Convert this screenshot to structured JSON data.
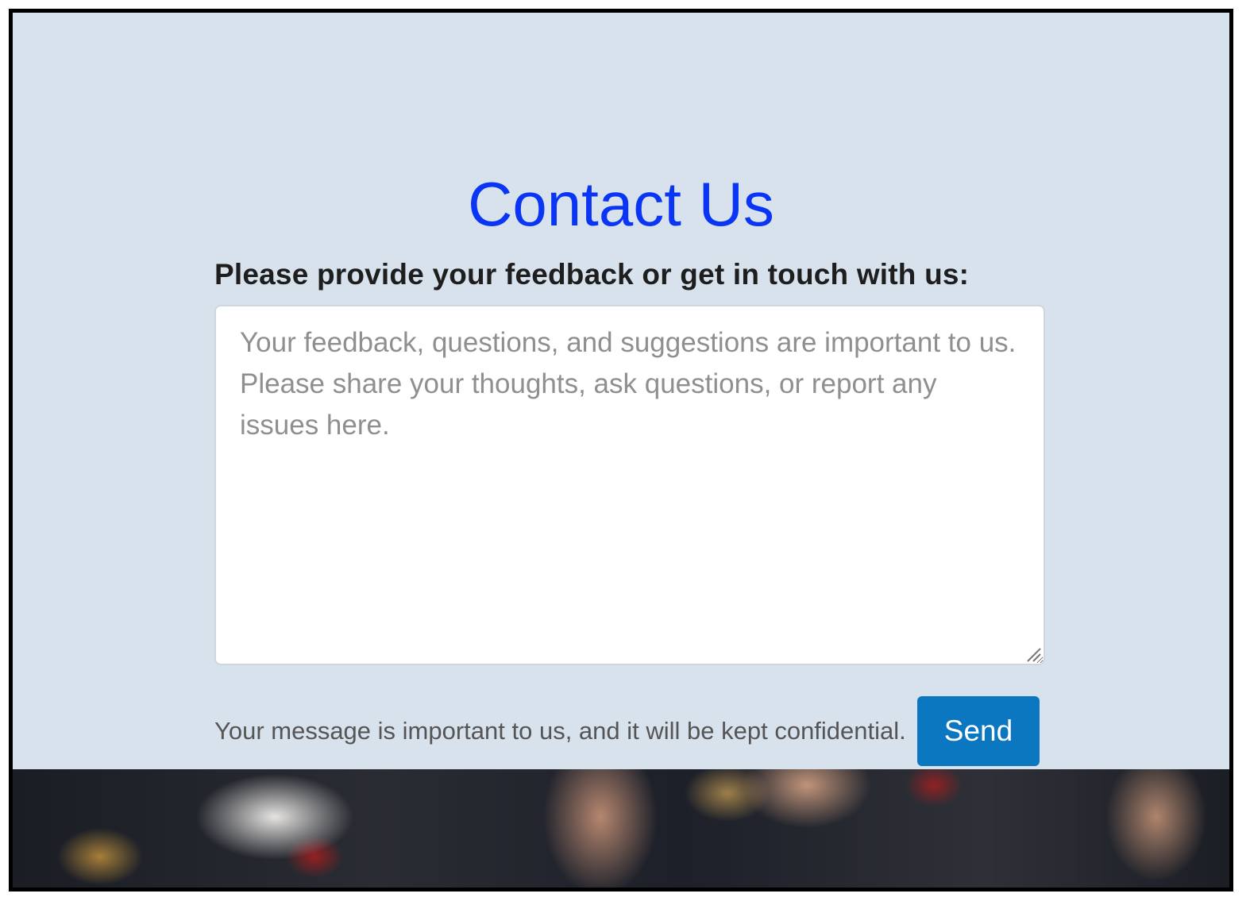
{
  "page": {
    "title": "Contact Us",
    "prompt_label": "Please provide your feedback or get in touch with us:",
    "message": {
      "value": "",
      "placeholder": "Your feedback, questions, and suggestions are important to us. Please share your thoughts, ask questions, or report any issues here."
    },
    "confidential_note": "Your message is important to us, and it will be kept confidential.",
    "send_label": "Send"
  },
  "colors": {
    "background": "#d8e2ec",
    "title": "#0a35f5",
    "button": "#0a77c0"
  }
}
